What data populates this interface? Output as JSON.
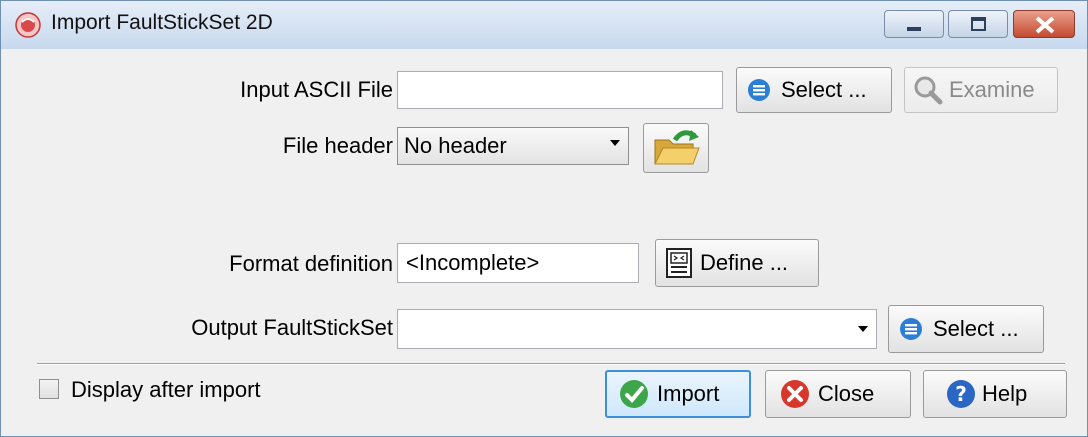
{
  "window": {
    "title": "Import FaultStickSet 2D"
  },
  "input_ascii": {
    "label": "Input ASCII File",
    "value": "",
    "select_label": "Select ...",
    "examine_label": "Examine"
  },
  "file_header": {
    "label": "File header",
    "selected": "No header"
  },
  "format": {
    "label": "Format definition",
    "value": "<Incomplete>",
    "define_label": "Define ..."
  },
  "output": {
    "label": "Output FaultStickSet",
    "value": "",
    "select_label": "Select ..."
  },
  "footer": {
    "display_after_import_label": "Display after import",
    "display_after_import_checked": false,
    "import_label": "Import",
    "close_label": "Close",
    "help_label": "Help"
  },
  "icons": {
    "app": "app-logo-icon",
    "select": "list-icon",
    "examine": "magnifier-icon",
    "folder": "open-folder-icon",
    "define": "define-document-icon",
    "import": "checkmark-icon",
    "close": "close-x-icon",
    "help": "question-icon"
  }
}
